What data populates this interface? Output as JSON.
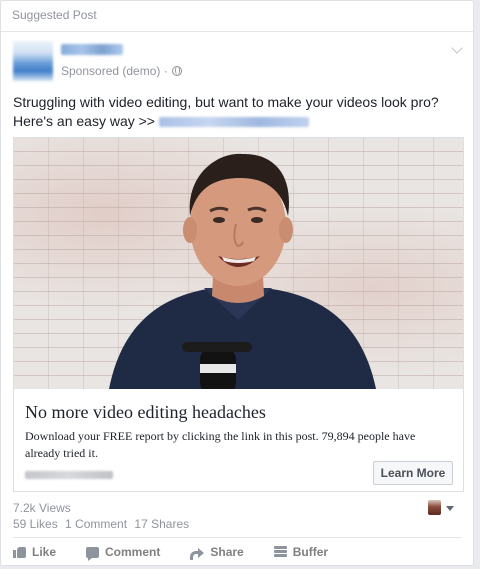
{
  "header": {
    "label": "Suggested Post"
  },
  "post": {
    "sponsored_label": "Sponsored (demo) ·",
    "text": "Struggling with video editing, but want to make your videos look pro? Here's an easy way >>"
  },
  "ad": {
    "headline": "No more video editing headaches",
    "description": "Download your FREE report by clicking the link in this post. 79,894 people have already tried it.",
    "cta_label": "Learn More"
  },
  "stats": {
    "views": "7.2k Views",
    "likes": "59 Likes",
    "comments": "1 Comment",
    "shares": "17 Shares"
  },
  "actions": [
    {
      "label": "Like",
      "icon": "like-icon"
    },
    {
      "label": "Comment",
      "icon": "comment-icon"
    },
    {
      "label": "Share",
      "icon": "share-icon"
    },
    {
      "label": "Buffer",
      "icon": "buffer-icon"
    }
  ],
  "colors": {
    "muted": "#90949c",
    "text": "#1d2129",
    "action": "#7f7f7f",
    "border": "#dddfe2"
  }
}
